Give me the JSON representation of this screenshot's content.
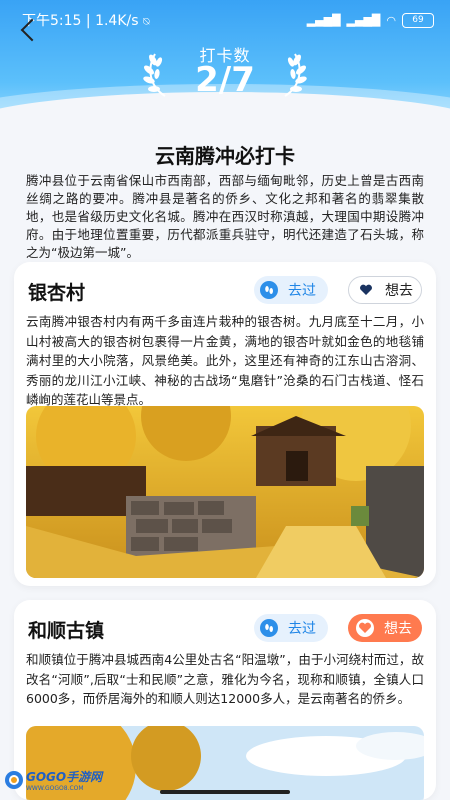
{
  "status_bar": {
    "time": "下午5:15",
    "speed": "1.4K/s",
    "signal1": "4G",
    "signal2": "4G",
    "battery": "69"
  },
  "header": {
    "counter_label": "打卡数",
    "counter_value": "2/7"
  },
  "page": {
    "title": "云南腾冲必打卡",
    "intro": "腾冲县位于云南省保山市西南部，西部与缅甸毗邻，历史上曾是古西南丝绸之路的要冲。腾冲县是著名的侨乡、文化之邦和著名的翡翠集散地，也是省级历史文化名城。腾冲在西汉时称滇越，大理国中期设腾冲府。由于地理位置重要，历代都派重兵驻守，明代还建造了石头城，称之为“极边第一城”。"
  },
  "places": [
    {
      "name": "银杏村",
      "went_label": "去过",
      "want_label": "想去",
      "want_active": false,
      "description": "云南腾冲银杏村内有两千多亩连片栽种的银杏树。九月底至十二月，小山村被高大的银杏树包裹得一片金黄，满地的银杏叶就如金色的地毯铺满村里的大小院落，风景绝美。此外，这里还有神奇的江东山古溶洞、秀丽的龙川江小江峡、神秘的古战场“鬼磨针”沧桑的石门古栈道、怪石嶙峋的莲花山等景点。"
    },
    {
      "name": "和顺古镇",
      "went_label": "去过",
      "want_label": "想去",
      "want_active": true,
      "description": "和顺镇位于腾冲县城西南4公里处古名“阳温墩”，由于小河绕村而过，故改名“河顺”,后取“士和民顺”之意，雅化为今名，现称和顺镇，全镇人口6000多，而侨居海外的和顺人则达12000多人，是云南著名的侨乡。"
    }
  ],
  "watermark": {
    "text": "GOGO手游网",
    "sub": "WWW.GOGO8.COM"
  },
  "colors": {
    "hero_top": "#39a3f5",
    "accent_blue": "#1f85e6",
    "want_active": "#ff7a4f"
  }
}
